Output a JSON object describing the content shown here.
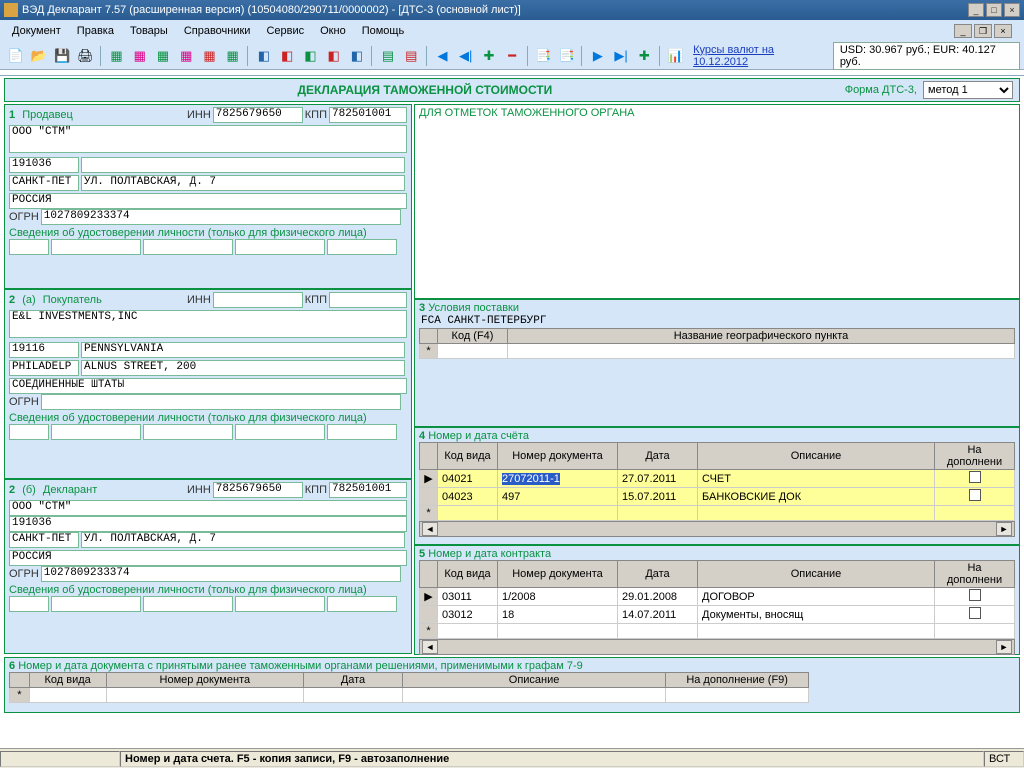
{
  "title": "ВЭД Декларант 7.57 (расширенная версия) (10504080/290711/0000002) - [ДТС-3 (основной лист)]",
  "menu": {
    "m0": "Документ",
    "m1": "Правка",
    "m2": "Товары",
    "m3": "Справочники",
    "m4": "Сервис",
    "m5": "Окно",
    "m6": "Помощь"
  },
  "rates": {
    "link": "Курсы валют на 10.12.2012",
    "text": "USD: 30.967 руб.; EUR: 40.127 руб."
  },
  "docheader": {
    "title": "ДЕКЛАРАЦИЯ ТАМОЖЕННОЙ СТОИМОСТИ",
    "formlbl": "Форма ДТС-3,",
    "method": "метод 1"
  },
  "box1": {
    "hdr": "Продавец",
    "num": "1",
    "inn_lbl": "ИНН",
    "inn": "7825679650",
    "kpp_lbl": "КПП",
    "kpp": "782501001",
    "name": "ООО \"СТМ\"",
    "post": "191036",
    "city": "САНКТ-ПЕТ",
    "street": "УЛ. ПОЛТАВСКАЯ, Д. 7",
    "country": "РОССИЯ",
    "ogrn_lbl": "ОГРН",
    "ogrn": "1027809233374",
    "idnote": "Сведения об удостоверении личности (только для физического лица)"
  },
  "box2a": {
    "hdr_num": "2",
    "hdr_sub": "(а)",
    "hdr": "Покупатель",
    "inn_lbl": "ИНН",
    "kpp_lbl": "КПП",
    "name": "E&L INVESTMENTS,INC",
    "post": "19116",
    "region": "PENNSYLVANIA",
    "city": "PHILADELP",
    "street": "ALNUS STREET, 200",
    "country": "СОЕДИНЕННЫЕ ШТАТЫ",
    "ogrn_lbl": "ОГРН",
    "idnote": "Сведения об удостоверении личности (только для физического лица)"
  },
  "box2b": {
    "hdr_num": "2",
    "hdr_sub": "(б)",
    "hdr": "Декларант",
    "inn_lbl": "ИНН",
    "inn": "7825679650",
    "kpp_lbl": "КПП",
    "kpp": "782501001",
    "name": "ООО \"СТМ\"",
    "post": "191036",
    "city": "САНКТ-ПЕТ",
    "street": "УЛ. ПОЛТАВСКАЯ, Д. 7",
    "country": "РОССИЯ",
    "ogrn_lbl": "ОГРН",
    "ogrn": "1027809233374",
    "idnote": "Сведения об удостоверении личности (только для физического лица)"
  },
  "boxR1": {
    "hdr": "ДЛЯ ОТМЕТОК ТАМОЖЕННОГО ОРГАНА"
  },
  "box3": {
    "num": "3",
    "hdr": "Условия поставки",
    "text": "FCA  САНКТ-ПЕТЕРБУРГ",
    "cols": {
      "code": "Код (F4)",
      "name": "Название географического пункта"
    },
    "star": "*"
  },
  "box4": {
    "num": "4",
    "hdr": "Номер и дата счёта",
    "cols": {
      "c1": "Код вида",
      "c2": "Номер документа",
      "c3": "Дата",
      "c4": "Описание",
      "c5": "На дополнени"
    },
    "rows": [
      {
        "arrow": "▶",
        "c1": "04021",
        "c2": "27072011-1",
        "c3": "27.07.2011",
        "c4": "СЧЕТ"
      },
      {
        "arrow": "",
        "c1": "04023",
        "c2": "497",
        "c3": "15.07.2011",
        "c4": "БАНКОВСКИЕ ДОК"
      }
    ],
    "star": "*"
  },
  "box5": {
    "num": "5",
    "hdr": "Номер и дата контракта",
    "cols": {
      "c1": "Код вида",
      "c2": "Номер документа",
      "c3": "Дата",
      "c4": "Описание",
      "c5": "На дополнени"
    },
    "rows": [
      {
        "arrow": "▶",
        "c1": "03011",
        "c2": "1/2008",
        "c3": "29.01.2008",
        "c4": "ДОГОВОР"
      },
      {
        "arrow": "",
        "c1": "03012",
        "c2": "18",
        "c3": "14.07.2011",
        "c4": "Документы, вносящ"
      }
    ],
    "star": "*"
  },
  "box6": {
    "num": "6",
    "hdr": "Номер и дата документа с принятыми ранее таможенными органами решениями, применимыми к графам 7-9",
    "cols": {
      "c1": "Код вида",
      "c2": "Номер документа",
      "c3": "Дата",
      "c4": "Описание",
      "c5": "На дополнение (F9)"
    },
    "star": "*"
  },
  "status": {
    "text": "Номер и дата счета. F5 - копия записи, F9 - автозаполнение",
    "caps": "ВСТ"
  }
}
